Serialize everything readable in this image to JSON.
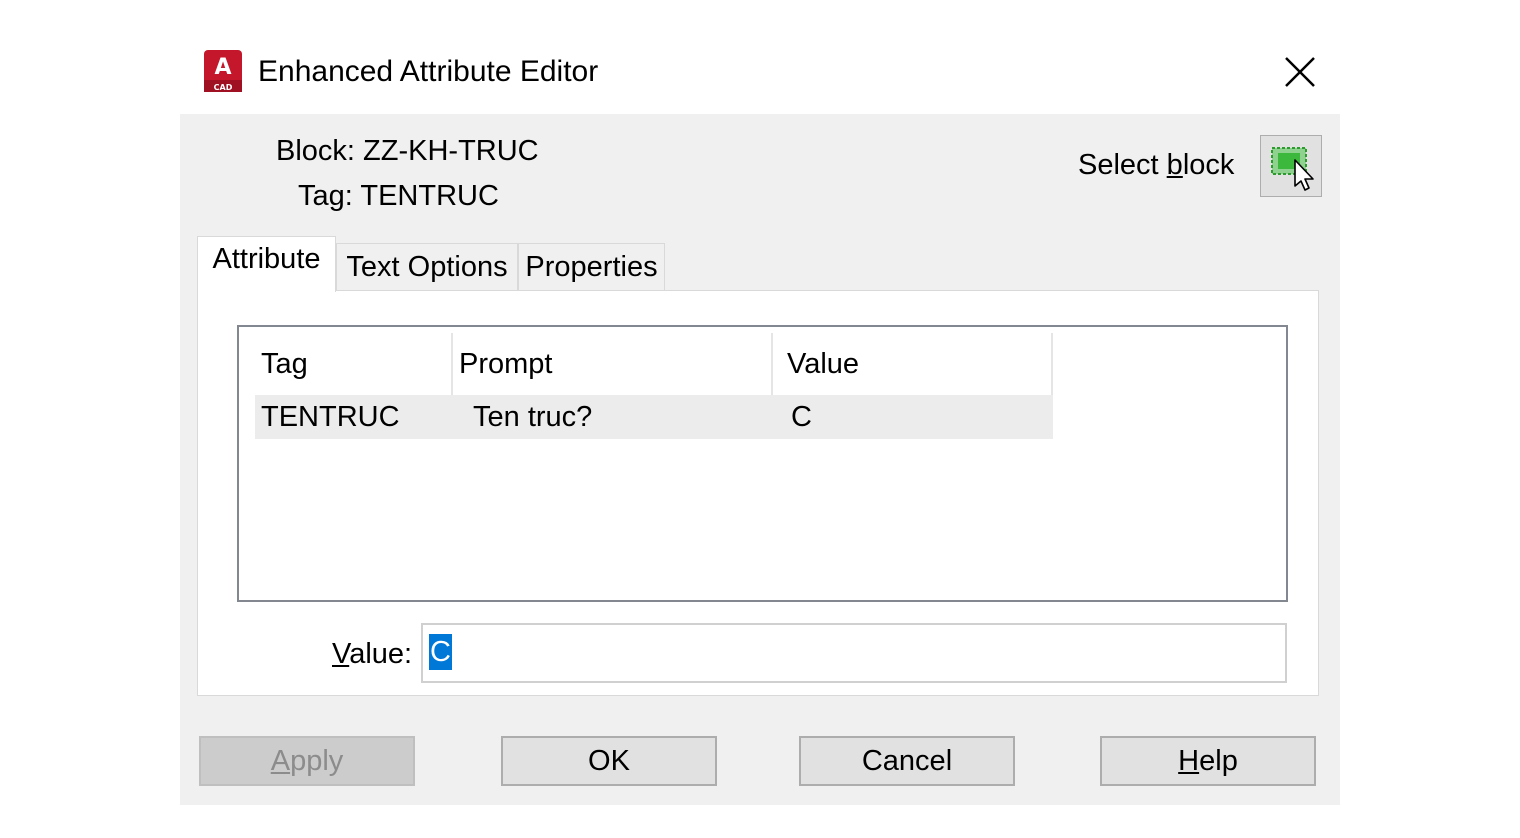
{
  "window": {
    "title": "Enhanced Attribute Editor",
    "icon": "autocad-app-icon",
    "icon_letter": "A",
    "icon_sub": "CAD",
    "accent_color": "#c4172c"
  },
  "header": {
    "block_label": "Block:",
    "block_value": "ZZ-KH-TRUC",
    "tag_label": "Tag:",
    "tag_value": "TENTRUC",
    "select_block_pre": "Select ",
    "select_block_key": "b",
    "select_block_post": "lock"
  },
  "tabs": [
    {
      "label": "Attribute",
      "active": true
    },
    {
      "label": "Text Options",
      "active": false
    },
    {
      "label": "Properties",
      "active": false
    }
  ],
  "table": {
    "columns": [
      "Tag",
      "Prompt",
      "Value"
    ],
    "rows": [
      {
        "tag": "TENTRUC",
        "prompt": "Ten truc?",
        "value": "C"
      }
    ]
  },
  "value_field": {
    "label_key": "V",
    "label_rest": "alue:",
    "value": "C",
    "selection_color": "#0078d7"
  },
  "buttons": {
    "apply_key": "A",
    "apply_rest": "pply",
    "apply_enabled": false,
    "ok": "OK",
    "cancel": "Cancel",
    "help_key": "H",
    "help_rest": "elp"
  }
}
